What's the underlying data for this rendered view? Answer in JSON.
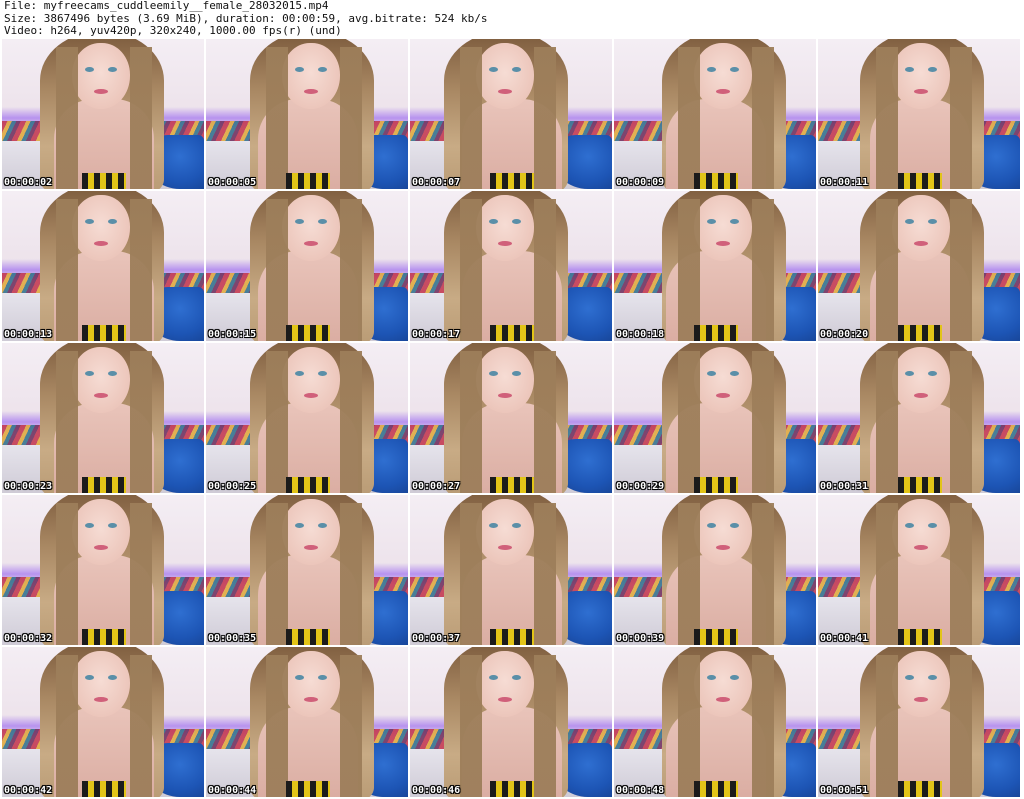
{
  "header": {
    "line1": "File: myfreecams_cuddleemily__female_28032015.mp4",
    "line2": "Size: 3867496 bytes (3.69 MiB), duration: 00:00:59, avg.bitrate: 524 kb/s",
    "line3": "Video: h264, yuv420p, 320x240, 1000.00 fps(r) (und)"
  },
  "thumbnails": [
    {
      "timestamp": "00:00:02"
    },
    {
      "timestamp": "00:00:05"
    },
    {
      "timestamp": "00:00:07"
    },
    {
      "timestamp": "00:00:09"
    },
    {
      "timestamp": "00:00:11"
    },
    {
      "timestamp": "00:00:13"
    },
    {
      "timestamp": "00:00:15"
    },
    {
      "timestamp": "00:00:17"
    },
    {
      "timestamp": "00:00:18"
    },
    {
      "timestamp": "00:00:20"
    },
    {
      "timestamp": "00:00:23"
    },
    {
      "timestamp": "00:00:25"
    },
    {
      "timestamp": "00:00:27"
    },
    {
      "timestamp": "00:00:29"
    },
    {
      "timestamp": "00:00:31"
    },
    {
      "timestamp": "00:00:32"
    },
    {
      "timestamp": "00:00:35"
    },
    {
      "timestamp": "00:00:37"
    },
    {
      "timestamp": "00:00:39"
    },
    {
      "timestamp": "00:00:41"
    },
    {
      "timestamp": "00:00:42"
    },
    {
      "timestamp": "00:00:44"
    },
    {
      "timestamp": "00:00:46"
    },
    {
      "timestamp": "00:00:48"
    },
    {
      "timestamp": "00:00:51"
    }
  ],
  "colors": {
    "background": "#ffffff",
    "header_text": "#111111",
    "timestamp_text": "#ffffff",
    "timestamp_outline": "#000000"
  }
}
